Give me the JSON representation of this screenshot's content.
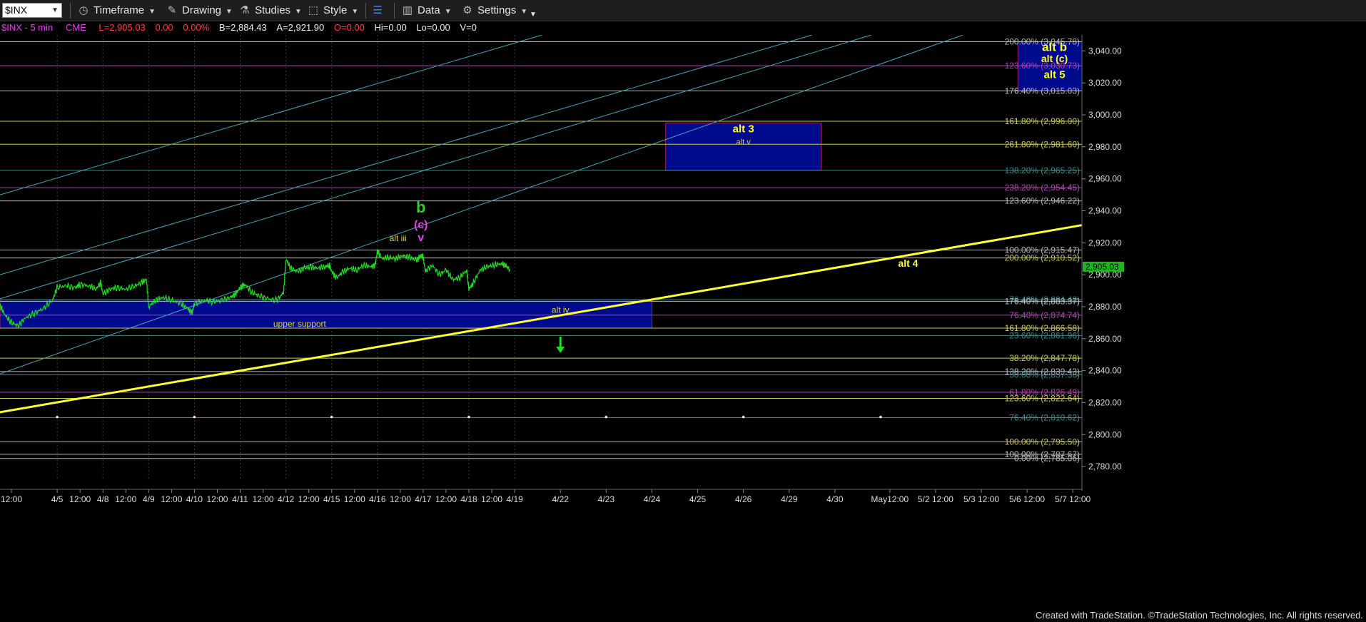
{
  "toolbar": {
    "symbol": "$INX",
    "timeframe": "Timeframe",
    "drawing": "Drawing",
    "studies": "Studies",
    "style": "Style",
    "data": "Data",
    "settings": "Settings"
  },
  "infobar": {
    "title": "$INX - 5 min",
    "exchange": "CME",
    "last": "L=2,905.03",
    "chg": "0.00",
    "pct": "0.00%",
    "bid": "B=2,884.43",
    "ask": "A=2,921.90",
    "open": "O=0.00",
    "high": "Hi=0.00",
    "low": "Lo=0.00",
    "vol": "V=0"
  },
  "colors": {
    "background": "#000000",
    "price": "#22dd22",
    "trendline": "#ffff33",
    "channel": "#4aa6bb",
    "box": "#000a8c",
    "fib_yellow": "#c8c85a",
    "fib_gray": "#b8b8b8",
    "fib_purple": "#b043b0",
    "fib_teal": "#3a8a8a",
    "label_green": "#33cc33",
    "label_magenta": "#e040e0",
    "label_yellow": "#ffff33"
  },
  "footer": "Created with TradeStation. ©TradeStation Technologies, Inc. All rights reserved.",
  "chart_data": {
    "type": "line",
    "title": "$INX - 5 min",
    "last_price": 2905.03,
    "last_price_label": "2,905.03",
    "ylim": [
      2772,
      3050
    ],
    "y_ticks": [
      2780,
      2800,
      2820,
      2840,
      2860,
      2880,
      2900,
      2920,
      2940,
      2960,
      2980,
      3000,
      3020,
      3040
    ],
    "y_tick_labels": [
      "2,780.00",
      "2,800.00",
      "2,820.00",
      "2,840.00",
      "2,860.00",
      "2,880.00",
      "2,900.00",
      "2,920.00",
      "2,940.00",
      "2,960.00",
      "2,980.00",
      "3,000.00",
      "3,020.00",
      "3,040.00"
    ],
    "x_range_sessions": [
      -0.25,
      23.4
    ],
    "x_tick_labels": [
      {
        "session": 0,
        "label": "12:00"
      },
      {
        "session": 1,
        "label": "4/5"
      },
      {
        "session": 1.5,
        "label": "12:00"
      },
      {
        "session": 2,
        "label": "4/8"
      },
      {
        "session": 2.5,
        "label": "12:00"
      },
      {
        "session": 3,
        "label": "4/9"
      },
      {
        "session": 3.5,
        "label": "12:00"
      },
      {
        "session": 4,
        "label": "4/10"
      },
      {
        "session": 4.5,
        "label": "12:00"
      },
      {
        "session": 5,
        "label": "4/11"
      },
      {
        "session": 5.5,
        "label": "12:00"
      },
      {
        "session": 6,
        "label": "4/12"
      },
      {
        "session": 6.5,
        "label": "12:00"
      },
      {
        "session": 7,
        "label": "4/15"
      },
      {
        "session": 7.5,
        "label": "12:00"
      },
      {
        "session": 8,
        "label": "4/16"
      },
      {
        "session": 8.5,
        "label": "12:00"
      },
      {
        "session": 9,
        "label": "4/17"
      },
      {
        "session": 9.5,
        "label": "12:00"
      },
      {
        "session": 10,
        "label": "4/18"
      },
      {
        "session": 10.5,
        "label": "12:00"
      },
      {
        "session": 11,
        "label": "4/19"
      },
      {
        "session": 12,
        "label": "4/22"
      },
      {
        "session": 13,
        "label": "4/23"
      },
      {
        "session": 14,
        "label": "4/24"
      },
      {
        "session": 15,
        "label": "4/25"
      },
      {
        "session": 16,
        "label": "4/26"
      },
      {
        "session": 17,
        "label": "4/29"
      },
      {
        "session": 18,
        "label": "4/30"
      },
      {
        "session": 19.2,
        "label": "May12:00"
      },
      {
        "session": 20.2,
        "label": "5/2 12:00"
      },
      {
        "session": 21.2,
        "label": "5/3 12:00"
      },
      {
        "session": 22.2,
        "label": "5/6 12:00"
      },
      {
        "session": 23.2,
        "label": "5/7 12:00"
      }
    ],
    "price_series": [
      [
        -0.25,
        2881
      ],
      [
        -0.15,
        2875
      ],
      [
        0,
        2870
      ],
      [
        0.15,
        2868
      ],
      [
        0.3,
        2873
      ],
      [
        0.5,
        2876
      ],
      [
        0.7,
        2879
      ],
      [
        0.9,
        2884
      ],
      [
        1,
        2892
      ],
      [
        1.2,
        2893
      ],
      [
        1.4,
        2892
      ],
      [
        1.5,
        2894
      ],
      [
        1.7,
        2893
      ],
      [
        1.85,
        2891
      ],
      [
        1.95,
        2895
      ],
      [
        2,
        2888
      ],
      [
        2.15,
        2891
      ],
      [
        2.3,
        2892
      ],
      [
        2.5,
        2891
      ],
      [
        2.7,
        2893
      ],
      [
        2.85,
        2895
      ],
      [
        2.95,
        2897
      ],
      [
        3,
        2880
      ],
      [
        3.15,
        2884
      ],
      [
        3.3,
        2886
      ],
      [
        3.5,
        2884
      ],
      [
        3.7,
        2882
      ],
      [
        3.85,
        2879
      ],
      [
        3.95,
        2876
      ],
      [
        4,
        2882
      ],
      [
        4.2,
        2884
      ],
      [
        4.4,
        2883
      ],
      [
        4.6,
        2884
      ],
      [
        4.8,
        2886
      ],
      [
        4.9,
        2888
      ],
      [
        5,
        2892
      ],
      [
        5.1,
        2894
      ],
      [
        5.25,
        2889
      ],
      [
        5.4,
        2887
      ],
      [
        5.6,
        2885
      ],
      [
        5.8,
        2884
      ],
      [
        5.95,
        2889
      ],
      [
        6,
        2910
      ],
      [
        6.1,
        2904
      ],
      [
        6.25,
        2902
      ],
      [
        6.4,
        2904
      ],
      [
        6.55,
        2905
      ],
      [
        6.7,
        2904
      ],
      [
        6.85,
        2905
      ],
      [
        6.95,
        2906
      ],
      [
        7,
        2902
      ],
      [
        7.1,
        2898
      ],
      [
        7.25,
        2902
      ],
      [
        7.4,
        2904
      ],
      [
        7.55,
        2903
      ],
      [
        7.7,
        2906
      ],
      [
        7.85,
        2905
      ],
      [
        7.95,
        2906
      ],
      [
        8,
        2915
      ],
      [
        8.1,
        2910
      ],
      [
        8.25,
        2911
      ],
      [
        8.4,
        2910
      ],
      [
        8.55,
        2912
      ],
      [
        8.7,
        2911
      ],
      [
        8.85,
        2909
      ],
      [
        8.95,
        2912
      ],
      [
        9,
        2911
      ],
      [
        9.05,
        2902
      ],
      [
        9.2,
        2906
      ],
      [
        9.35,
        2900
      ],
      [
        9.5,
        2903
      ],
      [
        9.65,
        2897
      ],
      [
        9.8,
        2898
      ],
      [
        9.95,
        2903
      ],
      [
        10,
        2891
      ],
      [
        10.1,
        2895
      ],
      [
        10.25,
        2903
      ],
      [
        10.4,
        2905
      ],
      [
        10.55,
        2906
      ],
      [
        10.7,
        2907
      ],
      [
        10.8,
        2906
      ],
      [
        10.9,
        2903
      ]
    ],
    "fib_levels": [
      {
        "label": "200.00% (3,045.78)",
        "value": 3045.78,
        "color": "#b8b8b8"
      },
      {
        "label": "123.60% (3,030.73)",
        "value": 3030.73,
        "color": "#b043b0"
      },
      {
        "label": "176.40% (3,015.03)",
        "value": 3015.03,
        "color": "#b8b8b8"
      },
      {
        "label": "161.80% (2,996.00)",
        "value": 2996.0,
        "color": "#c8c85a"
      },
      {
        "label": "261.80% (2,981.60)",
        "value": 2981.6,
        "color": "#c8c85a"
      },
      {
        "label": "138.20% (2,965.25)",
        "value": 2965.25,
        "color": "#3a8a8a"
      },
      {
        "label": "238.20% (2,954.45)",
        "value": 2954.45,
        "color": "#b043b0"
      },
      {
        "label": "123.60% (2,946.22)",
        "value": 2946.22,
        "color": "#b8b8b8"
      },
      {
        "label": "100.00% (2,915.47)",
        "value": 2915.47,
        "color": "#b8b8b8"
      },
      {
        "label": "200.00% (2,910.52)",
        "value": 2910.52,
        "color": "#c8c85a"
      },
      {
        "label": "76.40% (2,884.42)",
        "value": 2884.42,
        "color": "#3a8a8a"
      },
      {
        "label": "176.40% (2,883.37)",
        "value": 2883.37,
        "color": "#b8b8b8"
      },
      {
        "label": "76.40% (2,874.74)",
        "value": 2874.74,
        "color": "#b043b0"
      },
      {
        "label": "161.80% (2,866.58)",
        "value": 2866.58,
        "color": "#c8c85a"
      },
      {
        "label": "23.60% (2,861.96)",
        "value": 2861.96,
        "color": "#3a8a8a"
      },
      {
        "label": "38.20% (2,847.78)",
        "value": 2847.78,
        "color": "#c8c85a"
      },
      {
        "label": "138.20% (2,839.43)",
        "value": 2839.43,
        "color": "#b8b8b8"
      },
      {
        "label": "50.00% (2,837.36)",
        "value": 2837.36,
        "color": "#3a8a8a"
      },
      {
        "label": "61.80% (2,826.49)",
        "value": 2826.49,
        "color": "#b043b0"
      },
      {
        "label": "123.60% (2,822.64)",
        "value": 2822.64,
        "color": "#c8c85a"
      },
      {
        "label": "76.40% (2,810.62)",
        "value": 2810.62,
        "color": "#3a8a8a"
      },
      {
        "label": "100.00% (2,795.50)",
        "value": 2795.5,
        "color": "#c8c85a"
      },
      {
        "label": "100.00% (2,787.67)",
        "value": 2787.67,
        "color": "#b8b8b8"
      },
      {
        "label": "0.00% (2,785.06)",
        "value": 2785.06,
        "color": "#b8b8b8"
      }
    ],
    "boxes": [
      {
        "name": "upper-support",
        "x0": -0.25,
        "x1": 14.0,
        "y0": 2866.58,
        "y1": 2884.42,
        "labels": [
          "upper support",
          "alt iv"
        ]
      },
      {
        "name": "alt-3",
        "x0": 14.3,
        "x1": 17.7,
        "y0": 2965.25,
        "y1": 2995.0,
        "labels": [
          "alt 3",
          "alt v"
        ]
      },
      {
        "name": "alt-b",
        "x0": 22.0,
        "x1": 23.6,
        "y0": 3015.03,
        "y1": 3045.78,
        "labels": [
          "alt b",
          "alt (c)",
          "alt 5"
        ]
      }
    ],
    "trendline": {
      "x0": -0.25,
      "y0": 2814,
      "x1": 23.6,
      "y1": 2932
    },
    "channel_lines": [
      {
        "x0": -0.25,
        "y0": 2950,
        "x1": 11.6,
        "y1": 3050
      },
      {
        "x0": -0.25,
        "y0": 2900,
        "x1": 17.5,
        "y1": 3050
      },
      {
        "x0": -0.25,
        "y0": 2885,
        "x1": 18.8,
        "y1": 3050
      },
      {
        "x0": -0.25,
        "y0": 2838,
        "x1": 20.8,
        "y1": 3050
      }
    ],
    "annotations": [
      {
        "text": "b",
        "session": 8.95,
        "price": 2939,
        "color": "#33cc33",
        "size": 22,
        "weight": "bold"
      },
      {
        "text": "(c)",
        "session": 8.95,
        "price": 2929,
        "color": "#e040e0",
        "size": 16,
        "weight": "bold"
      },
      {
        "text": "v",
        "session": 8.95,
        "price": 2921,
        "color": "#e040e0",
        "size": 16,
        "weight": "bold"
      },
      {
        "text": "alt iii",
        "session": 8.45,
        "price": 2921,
        "color": "#e0d040",
        "size": 12,
        "weight": "normal"
      },
      {
        "text": "alt 4",
        "session": 19.6,
        "price": 2905,
        "color": "#ffff33",
        "size": 14,
        "weight": "bold"
      }
    ],
    "arrow": {
      "session": 12.0,
      "price": 2855,
      "color": "#22dd22",
      "direction": "down"
    },
    "gridline_sessions": [
      1,
      2,
      3,
      4,
      5,
      6,
      7,
      8,
      9,
      10,
      11
    ],
    "marker_dots": {
      "price": 2811,
      "sessions": [
        1,
        4,
        7,
        10,
        13,
        16,
        19
      ]
    }
  }
}
